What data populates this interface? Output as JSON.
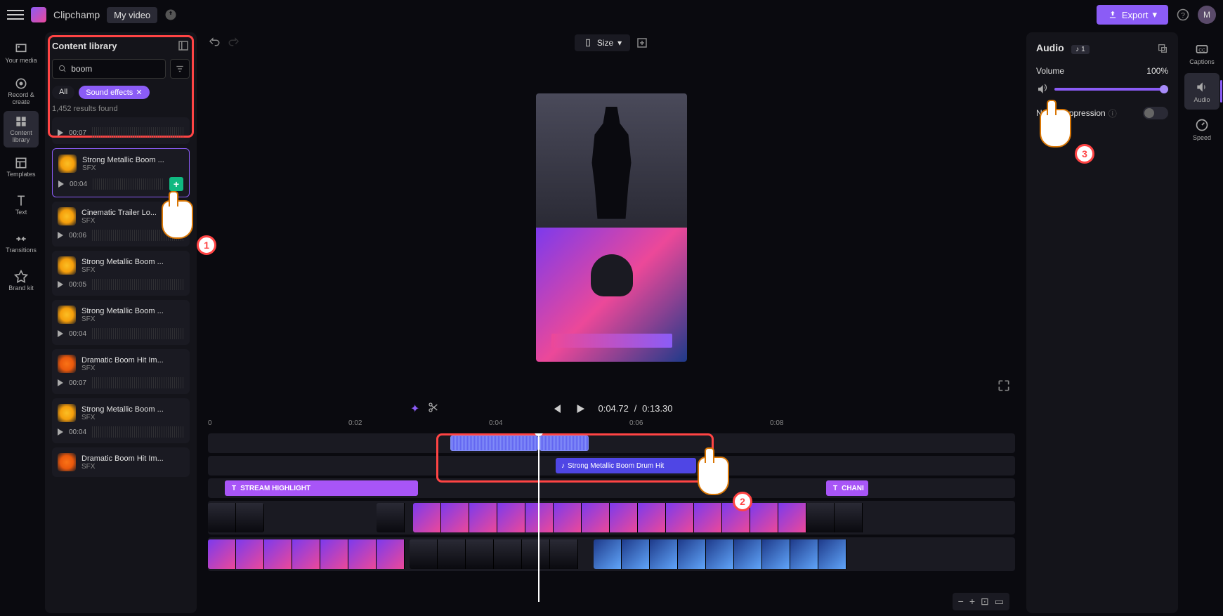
{
  "app": {
    "name": "Clipchamp",
    "project": "My video",
    "avatar_letter": "M"
  },
  "topbar": {
    "export": "Export"
  },
  "left_rail": [
    {
      "label": "Your media",
      "name": "your-media"
    },
    {
      "label": "Record & create",
      "name": "record-create"
    },
    {
      "label": "Content library",
      "name": "content-library",
      "active": true
    },
    {
      "label": "Templates",
      "name": "templates"
    },
    {
      "label": "Text",
      "name": "text"
    },
    {
      "label": "Transitions",
      "name": "transitions"
    },
    {
      "label": "Brand kit",
      "name": "brand-kit"
    }
  ],
  "sidebar": {
    "title": "Content library",
    "search_value": "boom",
    "search_placeholder": "Search",
    "chip_all": "All",
    "chip_sfx": "Sound effects",
    "results": "1,452 results found",
    "items": [
      {
        "name": "",
        "type": "",
        "dur": "00:07"
      },
      {
        "name": "Strong Metallic Boom ...",
        "type": "SFX",
        "dur": "00:04",
        "selected": true,
        "add": true
      },
      {
        "name": "Cinematic Trailer Lo...",
        "type": "SFX",
        "dur": "00:06"
      },
      {
        "name": "Strong Metallic Boom ...",
        "type": "SFX",
        "dur": "00:05"
      },
      {
        "name": "Strong Metallic Boom ...",
        "type": "SFX",
        "dur": "00:04"
      },
      {
        "name": "Dramatic Boom Hit Im...",
        "type": "SFX",
        "dur": "00:07",
        "orange": true
      },
      {
        "name": "Strong Metallic Boom ...",
        "type": "SFX",
        "dur": "00:04"
      },
      {
        "name": "Dramatic Boom Hit Im...",
        "type": "SFX",
        "orange": true
      }
    ]
  },
  "toolbar": {
    "size": "Size"
  },
  "controls": {
    "current": "0:04.72",
    "sep": "/",
    "total": "0:13.30"
  },
  "ruler": [
    "0",
    "0:02",
    "0:04",
    "0:06",
    "0:08"
  ],
  "timeline": {
    "music_label": "Strong Metallic Boom Drum Hit",
    "text1": "STREAM HIGHLIGHT",
    "text2": "CHANI"
  },
  "right_panel": {
    "title": "Audio",
    "badge": "1",
    "volume_label": "Volume",
    "volume_value": "100%",
    "noise_label": "Noise suppression"
  },
  "right_rail": [
    {
      "label": "Captions",
      "name": "captions"
    },
    {
      "label": "Audio",
      "name": "audio-tab",
      "active": true
    },
    {
      "label": "Speed",
      "name": "speed"
    }
  ],
  "cursors": {
    "c1": "1",
    "c2": "2",
    "c3": "3"
  }
}
